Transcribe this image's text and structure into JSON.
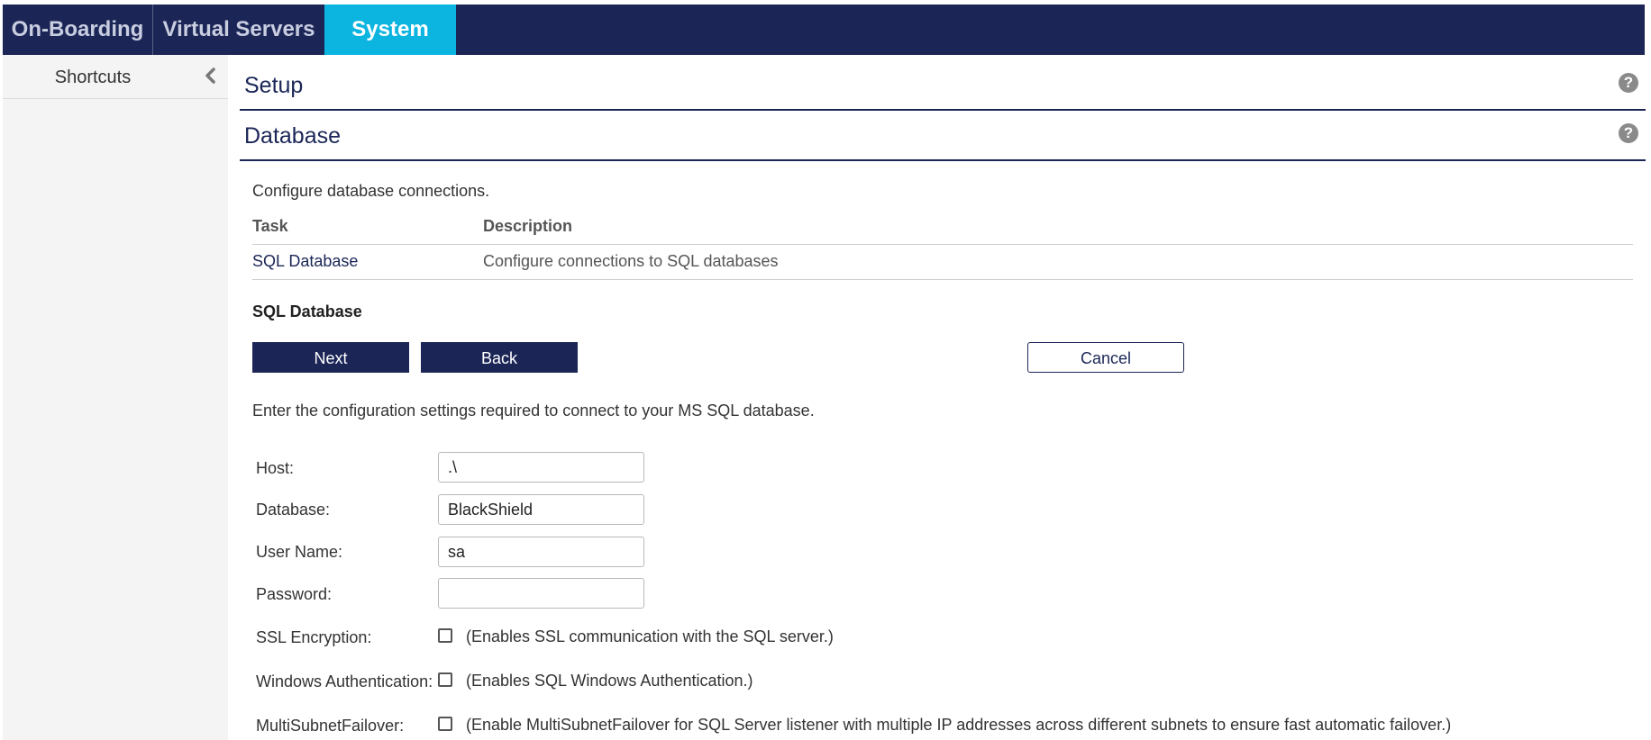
{
  "nav": {
    "tabs": [
      {
        "label": "On-Boarding"
      },
      {
        "label": "Virtual Servers"
      },
      {
        "label": "System"
      }
    ]
  },
  "sidebar": {
    "title": "Shortcuts",
    "collapse_icon": "chevron-left-icon"
  },
  "setup_panel": {
    "title": "Setup",
    "help_icon": "question-circle-icon"
  },
  "database_panel": {
    "title": "Database",
    "help_icon": "question-circle-icon"
  },
  "content": {
    "intro": "Configure database connections.",
    "table": {
      "headers": [
        "Task",
        "Description"
      ],
      "rows": [
        {
          "task": "SQL Database",
          "description": "Configure connections to SQL databases"
        }
      ]
    },
    "section_title": "SQL Database",
    "buttons": {
      "next": "Next",
      "back": "Back",
      "cancel": "Cancel"
    },
    "instructions": "Enter the configuration settings required to connect to your MS SQL database."
  },
  "form": {
    "host": {
      "label": "Host:",
      "value": ".\\"
    },
    "database": {
      "label": "Database:",
      "value": "BlackShield"
    },
    "username": {
      "label": "User Name:",
      "value": "sa"
    },
    "password": {
      "label": "Password:",
      "value": ""
    },
    "ssl": {
      "label": "SSL Encryption:",
      "description": "(Enables SSL communication with the SQL server.)",
      "checked": false
    },
    "windows_auth": {
      "label": "Windows Authentication:",
      "description": "(Enables SQL Windows Authentication.)",
      "checked": false
    },
    "multisubnet": {
      "label": "MultiSubnetFailover:",
      "description": "(Enable MultiSubnetFailover for SQL Server listener with multiple IP addresses across different subnets to ensure fast automatic failover.)",
      "checked": false
    }
  },
  "colors": {
    "nav_bg": "#1b2657",
    "active_tab": "#0cb4e0",
    "primary_button": "#1b2657",
    "sidebar_bg": "#f4f4f4"
  }
}
